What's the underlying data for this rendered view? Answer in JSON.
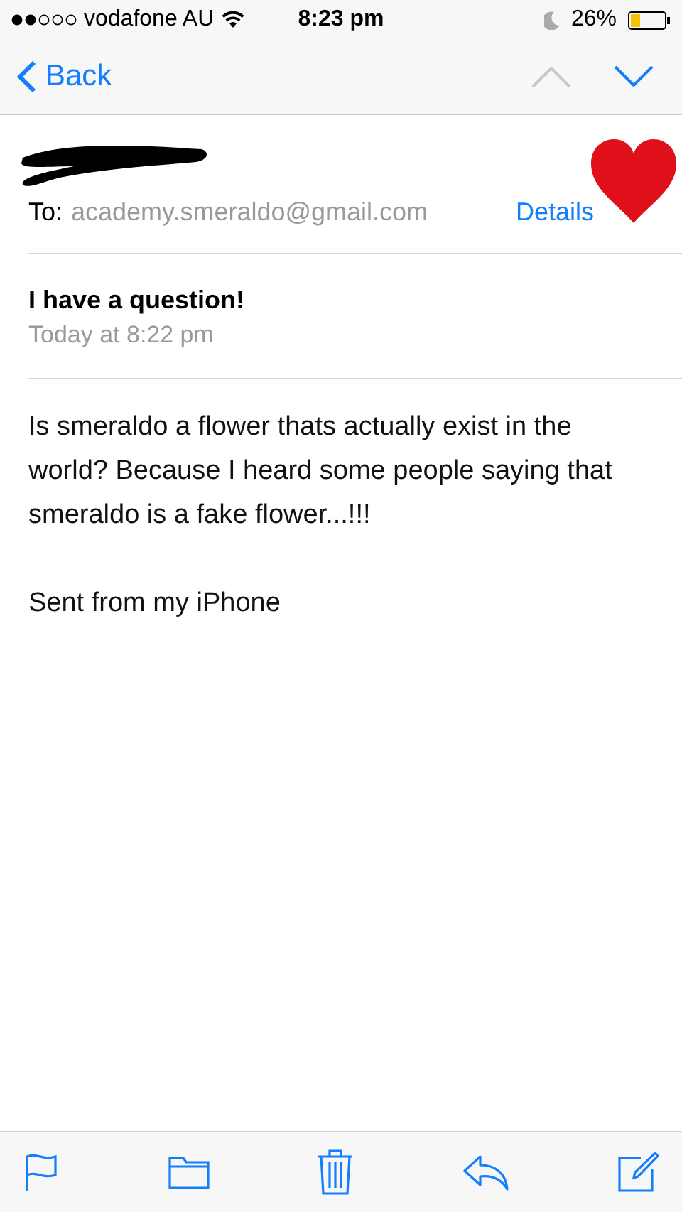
{
  "status_bar": {
    "carrier": "vodafone AU",
    "time": "8:23 pm",
    "battery": "26%"
  },
  "nav": {
    "back": "Back",
    "previous_disabled": true,
    "next_disabled": false
  },
  "header": {
    "to_label": "To:",
    "to_address": "academy.smeraldo@gmail.com",
    "details": "Details"
  },
  "message": {
    "subject": "I have a question!",
    "date": "Today at 8:22 pm",
    "paragraphs": [
      "Is smeraldo a flower thats actually exist in the world? Because I heard some people saying that smeraldo is a fake flower...!!!",
      "Sent from my iPhone"
    ]
  }
}
